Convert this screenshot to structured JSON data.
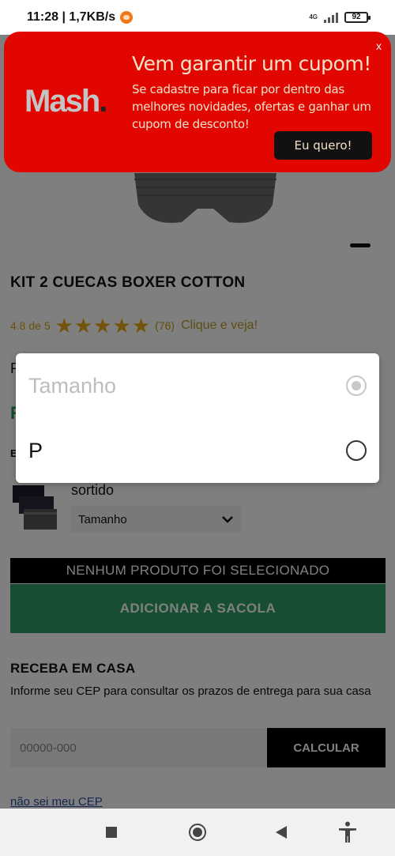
{
  "status_bar": {
    "time_speed": "11:28 | 1,7KB/s",
    "network": "4G",
    "battery": "92"
  },
  "promo": {
    "logo": "Mash",
    "logo_dot": ".",
    "close": "x",
    "headline": "Vem garantir um cupom!",
    "subtext": "Se cadastre para ficar por dentro das melhores novidades, ofertas e ganhar um cupom de desconto!",
    "cta": "Eu quero!"
  },
  "product": {
    "title": "KIT 2 CUECAS BOXER COTTON",
    "rating_text": "4.8 de 5",
    "rating_value": 4.8,
    "rating_max": 5,
    "review_count": "(76)",
    "reviews_cta": "Clique e veja!",
    "variant_label": "sortido",
    "size_select_value": "Tamanho",
    "none_selected": "NENHUM PRODUTO FOI SELECIONADO",
    "add_to_bag": "ADICIONAR A SACOLA"
  },
  "shipping": {
    "title": "RECEBA EM CASA",
    "text": "Informe seu CEP para consultar os prazos de entrega para sua casa",
    "cep_placeholder": "00000-000",
    "calc_button": "CALCULAR",
    "cep_link": "não sei meu CEP"
  },
  "size_dialog": {
    "options": [
      {
        "label": "Tamanho",
        "selected": true,
        "enabled": false
      },
      {
        "label": "P",
        "selected": false,
        "enabled": true
      }
    ]
  },
  "obscured": {
    "line1": "P",
    "line2": "R",
    "line3": "E"
  },
  "colors": {
    "promo_red": "#e10600",
    "add_to_bag_green": "#2e9d63",
    "star_gold": "#e6a817"
  }
}
